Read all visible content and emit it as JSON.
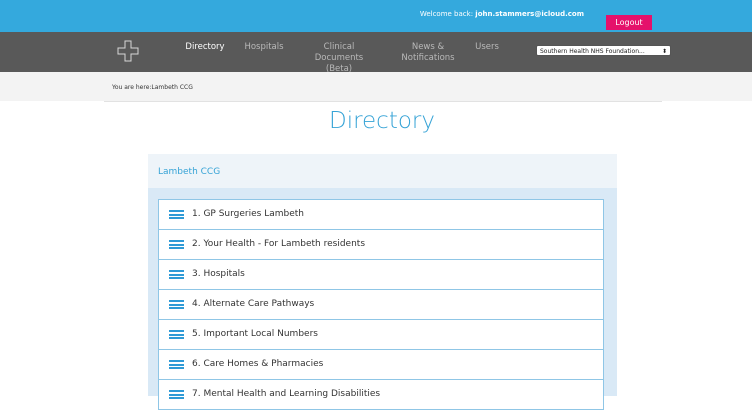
{
  "topbar": {
    "welcome_prefix": "Welcome back:",
    "user_email": "john.stammers@icloud.com",
    "logout_label": "Logout"
  },
  "nav": {
    "items": [
      {
        "label": "Directory"
      },
      {
        "label": "Hospitals"
      },
      {
        "label": "Clinical Documents (Beta)"
      },
      {
        "label": "News & Notifications"
      },
      {
        "label": "Users"
      }
    ],
    "org_select_value": "Southern Health NHS Foundation...",
    "org_select_arrow": "⬍"
  },
  "breadcrumb": {
    "text": "You are here:Lambeth CCG"
  },
  "page": {
    "title": "Directory"
  },
  "panel": {
    "title": "Lambeth CCG",
    "items": [
      {
        "label": "1. GP Surgeries Lambeth"
      },
      {
        "label": "2. Your Health - For Lambeth residents"
      },
      {
        "label": "3. Hospitals"
      },
      {
        "label": "4. Alternate Care Pathways"
      },
      {
        "label": "5. Important Local Numbers"
      },
      {
        "label": "6. Care Homes & Pharmacies"
      },
      {
        "label": "7. Mental Health and Learning Disabilities"
      }
    ]
  },
  "colors": {
    "topbar": "#34a9dd",
    "navbar": "#595959",
    "accent": "#36a3d6",
    "logout": "#e5116b"
  }
}
